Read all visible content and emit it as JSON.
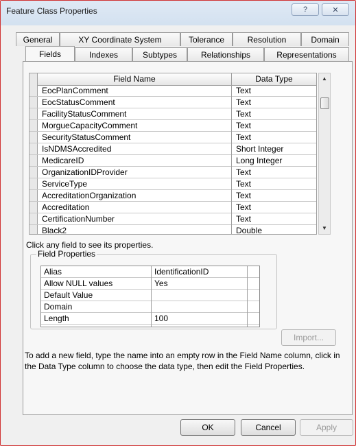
{
  "window": {
    "title": "Feature Class Properties",
    "help_glyph": "?",
    "close_glyph": "✕"
  },
  "tabs_back": [
    "General",
    "XY Coordinate System",
    "Tolerance",
    "Resolution",
    "Domain"
  ],
  "tabs_front": [
    "Fields",
    "Indexes",
    "Subtypes",
    "Relationships",
    "Representations"
  ],
  "active_tab": "Fields",
  "fields_table": {
    "columns": [
      "Field Name",
      "Data Type"
    ],
    "rows": [
      {
        "name": "EocPlanComment",
        "type": "Text"
      },
      {
        "name": "EocStatusComment",
        "type": "Text"
      },
      {
        "name": "FacilityStatusComment",
        "type": "Text"
      },
      {
        "name": "MorgueCapacityComment",
        "type": "Text"
      },
      {
        "name": "SecurityStatusComment",
        "type": "Text"
      },
      {
        "name": "IsNDMSAccredited",
        "type": "Short Integer"
      },
      {
        "name": "MedicareID",
        "type": "Long Integer"
      },
      {
        "name": "OrganizationIDProvider",
        "type": "Text"
      },
      {
        "name": "ServiceType",
        "type": "Text"
      },
      {
        "name": "AccreditationOrganization",
        "type": "Text"
      },
      {
        "name": "Accreditation",
        "type": "Text"
      },
      {
        "name": "CertificationNumber",
        "type": "Text"
      },
      {
        "name": "Black2",
        "type": "Double"
      }
    ]
  },
  "scroll": {
    "up_glyph": "▲",
    "down_glyph": "▼"
  },
  "click_hint": "Click any field to see its properties.",
  "field_properties": {
    "title": "Field Properties",
    "rows": [
      {
        "label": "Alias",
        "value": "IdentificationID"
      },
      {
        "label": "Allow NULL values",
        "value": "Yes"
      },
      {
        "label": "Default Value",
        "value": ""
      },
      {
        "label": "Domain",
        "value": ""
      },
      {
        "label": "Length",
        "value": "100"
      }
    ]
  },
  "import_button": "Import...",
  "instructions": [
    "To add a new field, type the name into an empty row in the Field Name column, click in",
    "the Data Type column to choose the data type, then edit the Field Properties."
  ],
  "buttons": {
    "ok": "OK",
    "cancel": "Cancel",
    "apply": "Apply"
  }
}
